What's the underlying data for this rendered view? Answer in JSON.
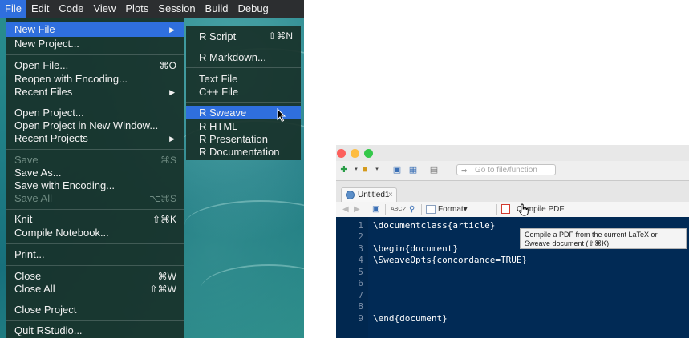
{
  "menubar": {
    "items": [
      "File",
      "Edit",
      "Code",
      "View",
      "Plots",
      "Session",
      "Build",
      "Debug"
    ],
    "active": "File"
  },
  "file_menu": {
    "new_file": "New File",
    "new_project": "New Project...",
    "open_file": "Open File...",
    "open_file_shortcut": "⌘O",
    "reopen_encoding": "Reopen with Encoding...",
    "recent_files": "Recent Files",
    "open_project": "Open Project...",
    "open_project_new_window": "Open Project in New Window...",
    "recent_projects": "Recent Projects",
    "save": "Save",
    "save_shortcut": "⌘S",
    "save_as": "Save As...",
    "save_with_encoding": "Save with Encoding...",
    "save_all": "Save All",
    "save_all_shortcut": "⌥⌘S",
    "knit": "Knit",
    "knit_shortcut": "⇧⌘K",
    "compile_notebook": "Compile Notebook...",
    "print": "Print...",
    "close": "Close",
    "close_shortcut": "⌘W",
    "close_all": "Close All",
    "close_all_shortcut": "⇧⌘W",
    "close_project": "Close Project",
    "quit": "Quit RStudio..."
  },
  "new_file_submenu": {
    "r_script": "R Script",
    "r_script_shortcut": "⇧⌘N",
    "r_markdown": "R Markdown...",
    "text_file": "Text File",
    "cpp_file": "C++ File",
    "r_sweave": "R Sweave",
    "r_html": "R HTML",
    "r_presentation": "R Presentation",
    "r_documentation": "R Documentation",
    "highlighted": "R Sweave"
  },
  "editor_window": {
    "goto_placeholder": "Go to file/function",
    "tab_title": "Untitled1",
    "tab_close": "×",
    "format_label": "Format",
    "compile_label": "Compile PDF",
    "tooltip_line1": "Compile a PDF from the current LaTeX or",
    "tooltip_line2": "Sweave document (⇧⌘K)",
    "lines": [
      {
        "num": "1",
        "cmd": "\\documentclass",
        "arg": "{article}"
      },
      {
        "num": "2",
        "cmd": "",
        "arg": ""
      },
      {
        "num": "3",
        "cmd": "\\begin",
        "arg": "{document}"
      },
      {
        "num": "4",
        "cmd": "\\SweaveOpts",
        "arg": "{concordance=TRUE}"
      },
      {
        "num": "5",
        "cmd": "",
        "arg": ""
      },
      {
        "num": "6",
        "cmd": "",
        "arg": ""
      },
      {
        "num": "7",
        "cmd": "",
        "arg": ""
      },
      {
        "num": "8",
        "cmd": "",
        "arg": ""
      },
      {
        "num": "9",
        "cmd": "\\end",
        "arg": "{document}"
      }
    ]
  },
  "colors": {
    "highlight": "#2f6fde",
    "menu_bg": "#18322a",
    "editor_bg": "#012a55",
    "traffic_close": "#fc605c",
    "traffic_min": "#fdbc40",
    "traffic_max": "#34c84a"
  }
}
